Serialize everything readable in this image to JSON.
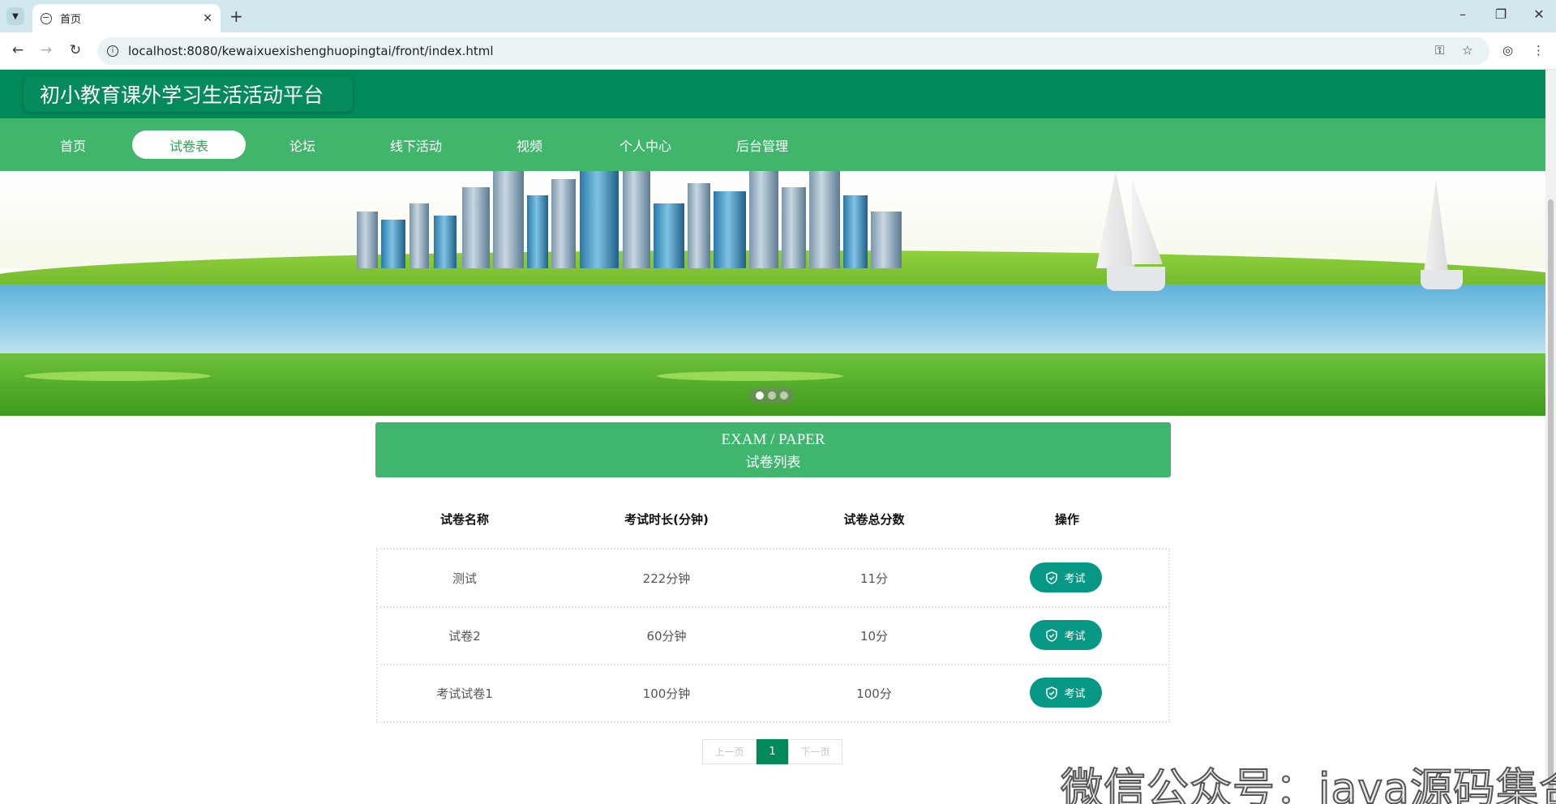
{
  "browser": {
    "tab_title": "首页",
    "url": "localhost:8080/kewaixuexishenghuopingtai/front/index.html",
    "icons": [
      "tab-list-icon",
      "globe-icon",
      "close-icon",
      "plus-icon",
      "minimize-icon",
      "restore-icon",
      "window-close-icon",
      "back-icon",
      "forward-icon",
      "reload-icon",
      "info-icon",
      "key-icon",
      "star-icon",
      "profile-icon",
      "menu-icon"
    ]
  },
  "site": {
    "title": "初小教育课外学习生活活动平台",
    "nav": [
      {
        "label": "首页",
        "active": false
      },
      {
        "label": "试卷表",
        "active": true
      },
      {
        "label": "论坛",
        "active": false
      },
      {
        "label": "线下活动",
        "active": false
      },
      {
        "label": "视频",
        "active": false
      },
      {
        "label": "个人中心",
        "active": false
      },
      {
        "label": "后台管理",
        "active": false
      }
    ],
    "carousel": {
      "count": 3,
      "active_index": 0
    },
    "colors": {
      "header": "#00895a",
      "nav": "#41b56c",
      "button": "#079785"
    }
  },
  "section": {
    "title_en": "EXAM / PAPER",
    "title_cn": "试卷列表"
  },
  "table": {
    "headers": [
      "试卷名称",
      "考试时长(分钟)",
      "试卷总分数",
      "操作"
    ],
    "rows": [
      {
        "name": "测试",
        "duration": "222分钟",
        "score": "11分",
        "action": "考试"
      },
      {
        "name": "试卷2",
        "duration": "60分钟",
        "score": "10分",
        "action": "考试"
      },
      {
        "name": "考试试卷1",
        "duration": "100分钟",
        "score": "100分",
        "action": "考试"
      }
    ]
  },
  "pagination": {
    "prev": "上一页",
    "current": "1",
    "next": "下一页"
  },
  "watermark": "微信公众号：java源码集合"
}
